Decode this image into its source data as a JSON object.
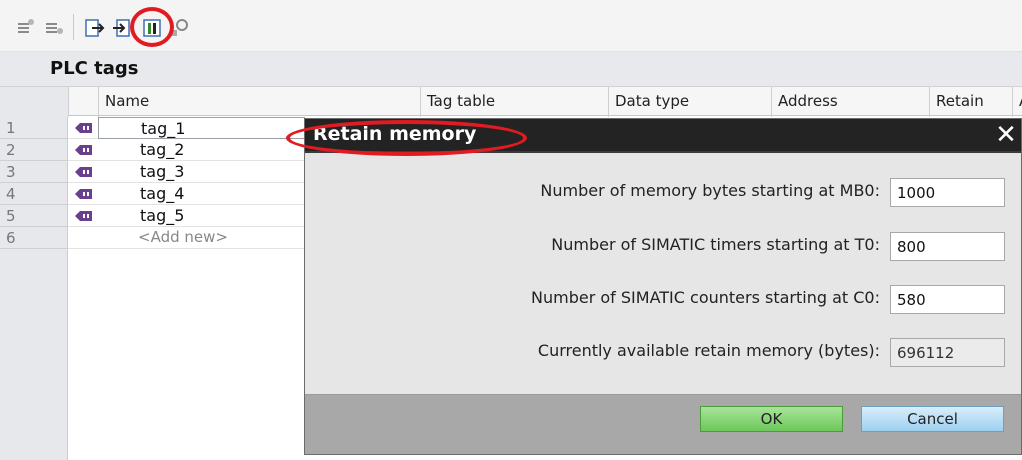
{
  "toolbar": {
    "buttons": [
      {
        "icon": "insert-row-icon"
      },
      {
        "icon": "add-row-icon"
      },
      {
        "icon": "export-icon"
      },
      {
        "icon": "import-icon"
      },
      {
        "icon": "retain-icon"
      },
      {
        "icon": "monitor-icon"
      }
    ],
    "highlight_color": "#e01b22"
  },
  "panel": {
    "title": "PLC tags"
  },
  "table": {
    "columns": [
      "Name",
      "Tag table",
      "Data type",
      "Address",
      "Retain",
      "A"
    ],
    "rows": [
      {
        "num": "1",
        "name": "tag_1"
      },
      {
        "num": "2",
        "name": "tag_2"
      },
      {
        "num": "3",
        "name": "tag_3"
      },
      {
        "num": "4",
        "name": "tag_4"
      },
      {
        "num": "5",
        "name": "tag_5"
      },
      {
        "num": "6",
        "name": "<Add new>"
      }
    ]
  },
  "dialog": {
    "title": "Retain memory",
    "close_symbol": "✕",
    "fields": [
      {
        "label": "Number of memory bytes starting at MB0:",
        "value": "1000"
      },
      {
        "label": "Number of SIMATIC timers starting at T0:",
        "value": "800"
      },
      {
        "label": "Number of SIMATIC counters starting at C0:",
        "value": "580"
      },
      {
        "label": "Currently available retain memory (bytes):",
        "value": "696112"
      }
    ],
    "ok_label": "OK",
    "cancel_label": "Cancel"
  }
}
